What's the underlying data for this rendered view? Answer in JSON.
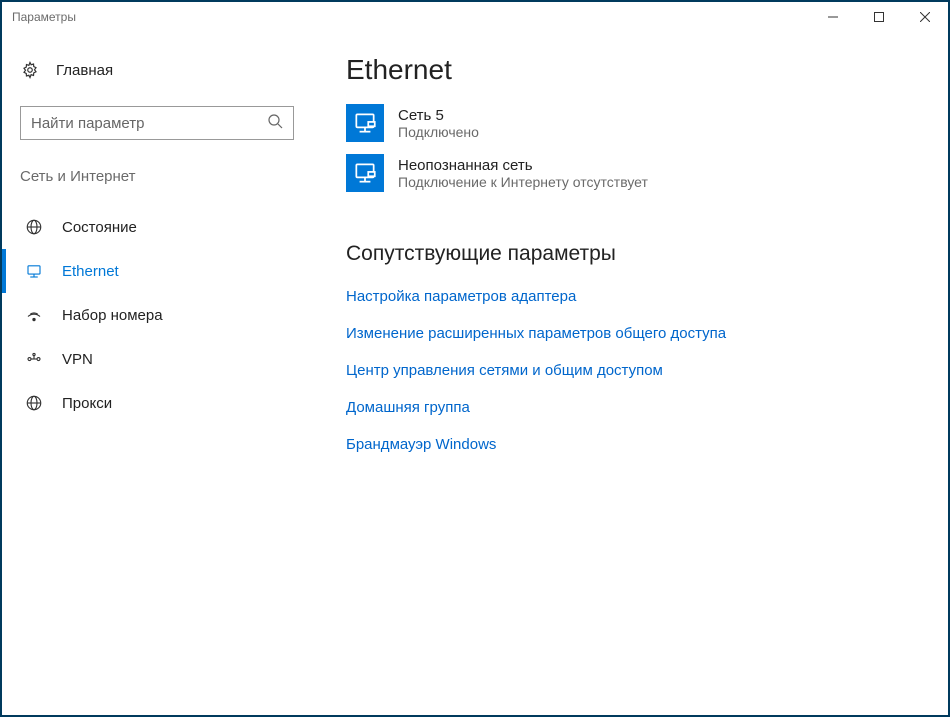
{
  "window": {
    "title": "Параметры"
  },
  "sidebar": {
    "home_label": "Главная",
    "search_placeholder": "Найти параметр",
    "category": "Сеть и Интернет",
    "items": [
      {
        "id": "status",
        "label": "Состояние",
        "active": false
      },
      {
        "id": "ethernet",
        "label": "Ethernet",
        "active": true
      },
      {
        "id": "dialup",
        "label": "Набор номера",
        "active": false
      },
      {
        "id": "vpn",
        "label": "VPN",
        "active": false
      },
      {
        "id": "proxy",
        "label": "Прокси",
        "active": false
      }
    ]
  },
  "main": {
    "heading": "Ethernet",
    "networks": [
      {
        "name": "Сеть  5",
        "status": "Подключено"
      },
      {
        "name": "Неопознанная сеть",
        "status": "Подключение к Интернету отсутствует"
      }
    ],
    "related_heading": "Сопутствующие параметры",
    "related_links": [
      "Настройка параметров адаптера",
      "Изменение расширенных параметров общего доступа",
      "Центр управления сетями и общим доступом",
      "Домашняя группа",
      "Брандмауэр Windows"
    ]
  }
}
